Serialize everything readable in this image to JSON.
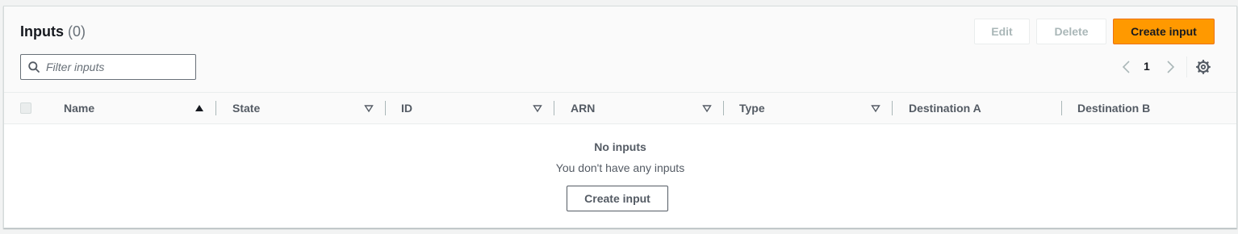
{
  "header": {
    "title": "Inputs",
    "count": "(0)",
    "edit_label": "Edit",
    "delete_label": "Delete",
    "create_label": "Create input"
  },
  "search": {
    "placeholder": "Filter inputs",
    "value": ""
  },
  "pagination": {
    "current_page": "1"
  },
  "table": {
    "columns": [
      {
        "label": "Name",
        "sort": "ascending"
      },
      {
        "label": "State",
        "sort": "none"
      },
      {
        "label": "ID",
        "sort": "none"
      },
      {
        "label": "ARN",
        "sort": "none"
      },
      {
        "label": "Type",
        "sort": "none"
      },
      {
        "label": "Destination A",
        "sort": "none"
      },
      {
        "label": "Destination B",
        "sort": "none"
      }
    ]
  },
  "empty_state": {
    "title": "No inputs",
    "subtitle": "You don't have any inputs",
    "button_label": "Create input"
  },
  "colors": {
    "primary": "#ff9900",
    "primary_border": "#ec7211",
    "header_bg": "#fafafa",
    "text": "#16191f",
    "muted": "#545b64"
  }
}
